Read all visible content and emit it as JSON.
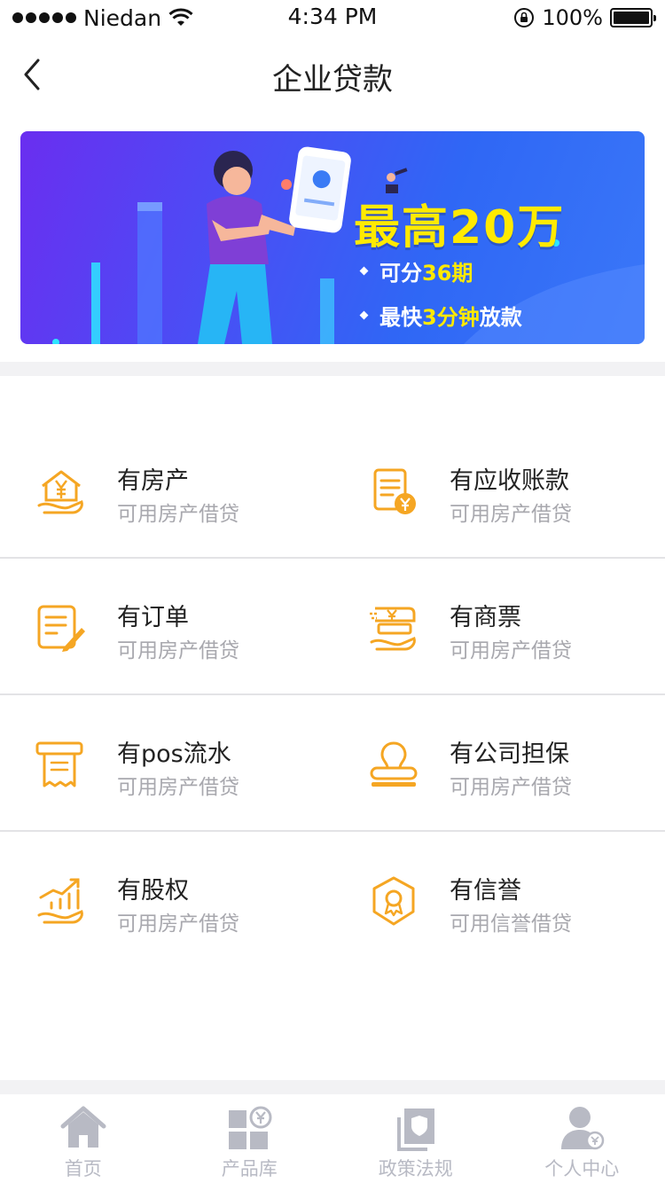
{
  "status_bar": {
    "carrier": "Niedan",
    "time": "4:34 PM",
    "battery": "100%"
  },
  "nav": {
    "title": "企业贷款"
  },
  "banner": {
    "headline": "最高20万",
    "bullet1_prefix": "可分",
    "bullet1_highlight": "36期",
    "bullet2_prefix": "最快",
    "bullet2_highlight": "3分钟",
    "bullet2_suffix": "放款"
  },
  "loan_types": [
    {
      "title": "有房产",
      "subtitle": "可用房产借贷",
      "icon": "house-yuan-icon"
    },
    {
      "title": "有应收账款",
      "subtitle": "可用房产借贷",
      "icon": "receivable-doc-icon"
    },
    {
      "title": "有订单",
      "subtitle": "可用房产借贷",
      "icon": "order-edit-icon"
    },
    {
      "title": "有商票",
      "subtitle": "可用房产借贷",
      "icon": "commercial-bill-icon"
    },
    {
      "title": "有pos流水",
      "subtitle": "可用房产借贷",
      "icon": "pos-receipt-icon"
    },
    {
      "title": "有公司担保",
      "subtitle": "可用房产借贷",
      "icon": "company-seal-icon"
    },
    {
      "title": "有股权",
      "subtitle": "可用房产借贷",
      "icon": "equity-growth-icon"
    },
    {
      "title": "有信誉",
      "subtitle": "可用信誉借贷",
      "icon": "credit-badge-icon"
    }
  ],
  "tab_bar": {
    "tabs": [
      {
        "label": "首页",
        "icon": "home-icon"
      },
      {
        "label": "产品库",
        "icon": "product-grid-icon"
      },
      {
        "label": "政策法规",
        "icon": "policy-shield-icon"
      },
      {
        "label": "个人中心",
        "icon": "user-icon"
      }
    ]
  },
  "colors": {
    "accent_orange": "#f5a623",
    "headline_yellow": "#ffea00",
    "tab_gray": "#b8bac4",
    "subtitle_gray": "#a8a8ae"
  }
}
